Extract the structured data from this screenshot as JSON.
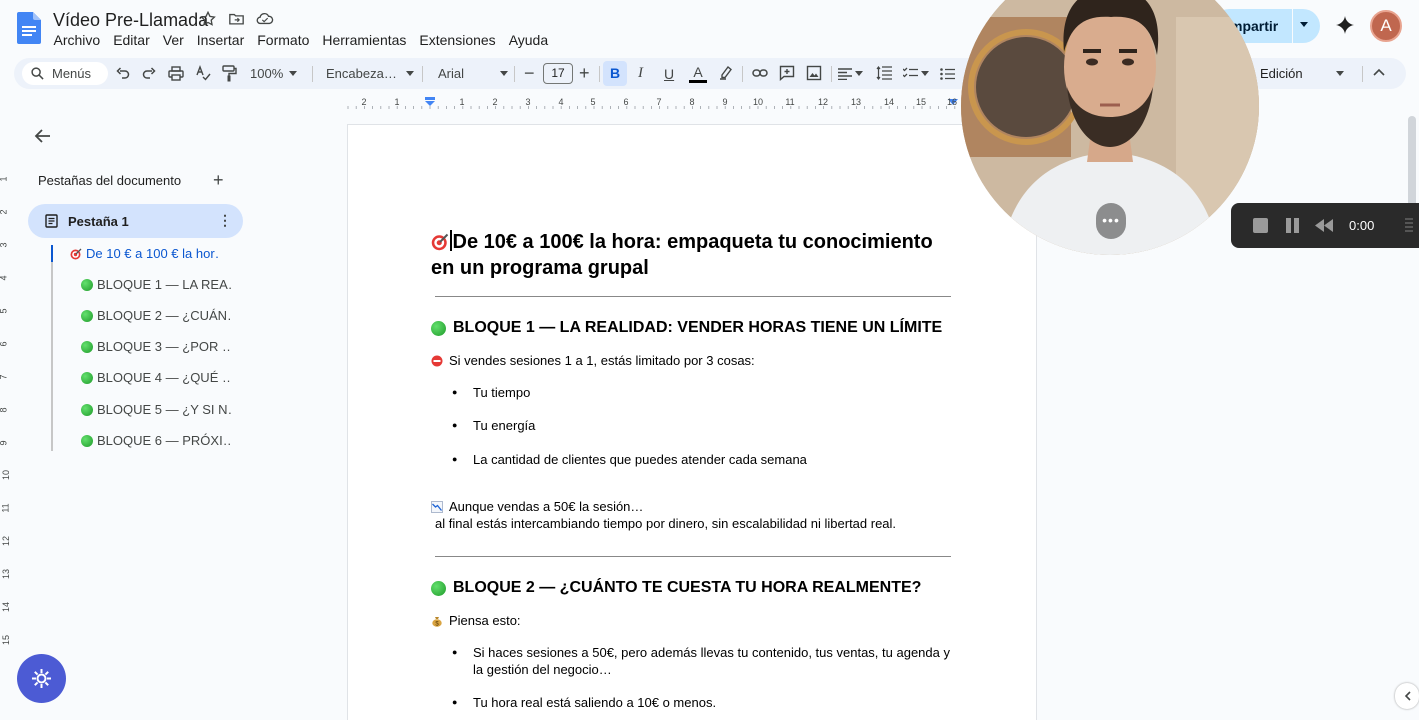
{
  "header": {
    "title": "Vídeo Pre-Llamada",
    "menu": [
      "Archivo",
      "Editar",
      "Ver",
      "Insertar",
      "Formato",
      "Herramientas",
      "Extensiones",
      "Ayuda"
    ],
    "share_label": "mpartir",
    "avatar_letter": "A"
  },
  "toolbar": {
    "search_label": "Menús",
    "zoom": "100%",
    "style": "Encabeza…",
    "font": "Arial",
    "font_size": "17",
    "bold": "B",
    "italic": "I",
    "underline": "U",
    "text_color_letter": "A",
    "mode": "Edición"
  },
  "ruler": {
    "numbers": [
      "2",
      "1",
      "1",
      "2",
      "3",
      "4",
      "5",
      "6",
      "7",
      "8",
      "9",
      "10",
      "11",
      "12",
      "13",
      "14",
      "15",
      "16"
    ]
  },
  "vruler": {
    "numbers": [
      "1",
      "2",
      "3",
      "4",
      "5",
      "6",
      "7",
      "8",
      "9",
      "10",
      "11",
      "12",
      "13",
      "14",
      "15"
    ]
  },
  "sidebar": {
    "title": "Pestañas del documento",
    "add": "+",
    "tab_label": "Pestaña 1",
    "outline": [
      "De 10 € a 100 € la hor…",
      "BLOQUE 1 — LA REA…",
      "BLOQUE 2 — ¿CUÁN…",
      "BLOQUE 3 — ¿POR …",
      "BLOQUE 4 — ¿QUÉ …",
      "BLOQUE 5 — ¿Y SI N…",
      "BLOQUE 6 — PRÓXI…"
    ]
  },
  "document": {
    "title": "De 10€ a 100€ la hora: empaqueta tu conocimiento en un programa grupal",
    "block1": {
      "heading": "BLOQUE 1 — LA REALIDAD: VENDER HORAS TIENE UN LÍMITE",
      "intro": "Si vendes sesiones 1 a 1, estás limitado por 3 cosas:",
      "bullets": [
        "Tu tiempo",
        "Tu energía",
        "La cantidad de clientes que puedes atender cada semana"
      ],
      "note_line1": "Aunque vendas a 50€ la sesión…",
      "note_line2": "al final estás intercambiando tiempo por dinero, sin escalabilidad ni libertad real."
    },
    "block2": {
      "heading": "BLOQUE 2 — ¿CUÁNTO TE CUESTA TU HORA REALMENTE?",
      "intro": "Piensa esto:",
      "bullets": [
        "Si haces sesiones a 50€, pero además llevas tu contenido, tus ventas, tu agenda y la gestión del negocio…",
        "Tu hora real está saliendo a 10€ o menos."
      ]
    }
  },
  "recorder": {
    "time": "0:00"
  }
}
